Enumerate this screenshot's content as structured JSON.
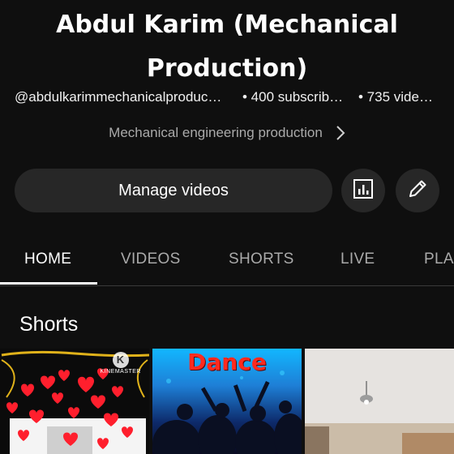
{
  "channel": {
    "name": "Abdul Karim (Mechanical Production)",
    "handle": "@abdulkarimmechanicalproduc…",
    "subscribers": "• 400 subscrib…",
    "videos": "• 735 vide…",
    "description": "Mechanical engineering production"
  },
  "actions": {
    "manage_label": "Manage videos",
    "analytics_icon": "analytics-icon",
    "edit_icon": "pencil-icon"
  },
  "tabs": [
    {
      "label": "HOME",
      "active": true
    },
    {
      "label": "VIDEOS",
      "active": false
    },
    {
      "label": "SHORTS",
      "active": false
    },
    {
      "label": "LIVE",
      "active": false
    },
    {
      "label": "PLA",
      "active": false
    }
  ],
  "shorts": {
    "title": "Shorts",
    "items": [
      {
        "thumb_text": "",
        "badge": "KINEMASTER",
        "badge_letter": "K"
      },
      {
        "thumb_text": "Dance"
      },
      {
        "thumb_text": ""
      }
    ]
  },
  "colors": {
    "background": "#0f0f0f",
    "button_bg": "#272727",
    "secondary_text": "#aaaaaa",
    "dance_text": "#ff2a1e"
  }
}
